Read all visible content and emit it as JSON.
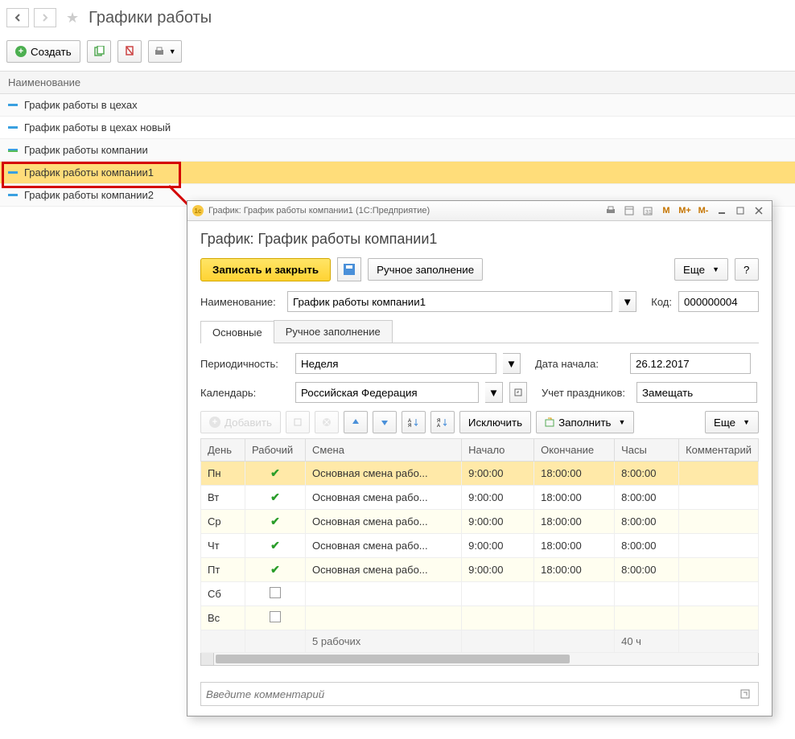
{
  "header": {
    "title": "Графики работы"
  },
  "toolbar": {
    "create": "Создать"
  },
  "list": {
    "header": "Наименование",
    "items": [
      {
        "name": "График работы в цехах"
      },
      {
        "name": "График работы в цехах новый"
      },
      {
        "name": "График работы компании"
      },
      {
        "name": "График работы компании1"
      },
      {
        "name": "График работы компании2"
      }
    ]
  },
  "dialog": {
    "titlebar": "График: График работы компании1  (1С:Предприятие)",
    "title": "График: График работы компании1",
    "save_close": "Записать и закрыть",
    "manual_fill": "Ручное заполнение",
    "more": "Еще",
    "help": "?",
    "name_label": "Наименование:",
    "name_value": "График работы компании1",
    "code_label": "Код:",
    "code_value": "000000004",
    "tabs": {
      "main": "Основные",
      "manual": "Ручное заполнение"
    },
    "period_label": "Периодичность:",
    "period_value": "Неделя",
    "start_label": "Дата начала:",
    "start_value": "26.12.2017",
    "calendar_label": "Календарь:",
    "calendar_value": "Российская Федерация",
    "holidays_label": "Учет праздников:",
    "holidays_value": "Замещать",
    "inner": {
      "add": "Добавить",
      "exclude": "Исключить",
      "fill": "Заполнить",
      "more": "Еще"
    },
    "table": {
      "cols": {
        "day": "День",
        "work": "Рабочий",
        "shift": "Смена",
        "start": "Начало",
        "end": "Окончание",
        "hours": "Часы",
        "comment": "Комментарий"
      },
      "rows": [
        {
          "day": "Пн",
          "work": true,
          "shift": "Основная смена рабо...",
          "start": "9:00:00",
          "end": "18:00:00",
          "hours": "8:00:00"
        },
        {
          "day": "Вт",
          "work": true,
          "shift": "Основная смена рабо...",
          "start": "9:00:00",
          "end": "18:00:00",
          "hours": "8:00:00"
        },
        {
          "day": "Ср",
          "work": true,
          "shift": "Основная смена рабо...",
          "start": "9:00:00",
          "end": "18:00:00",
          "hours": "8:00:00"
        },
        {
          "day": "Чт",
          "work": true,
          "shift": "Основная смена рабо...",
          "start": "9:00:00",
          "end": "18:00:00",
          "hours": "8:00:00"
        },
        {
          "day": "Пт",
          "work": true,
          "shift": "Основная смена рабо...",
          "start": "9:00:00",
          "end": "18:00:00",
          "hours": "8:00:00"
        },
        {
          "day": "Сб",
          "work": false,
          "shift": "",
          "start": "",
          "end": "",
          "hours": ""
        },
        {
          "day": "Вс",
          "work": false,
          "shift": "",
          "start": "",
          "end": "",
          "hours": ""
        }
      ],
      "footer": {
        "workdays": "5 рабочих",
        "total": "40 ч"
      }
    },
    "comment_placeholder": "Введите комментарий"
  },
  "titlebar_btns": {
    "m": "M",
    "mp": "M+",
    "mm": "M-"
  }
}
